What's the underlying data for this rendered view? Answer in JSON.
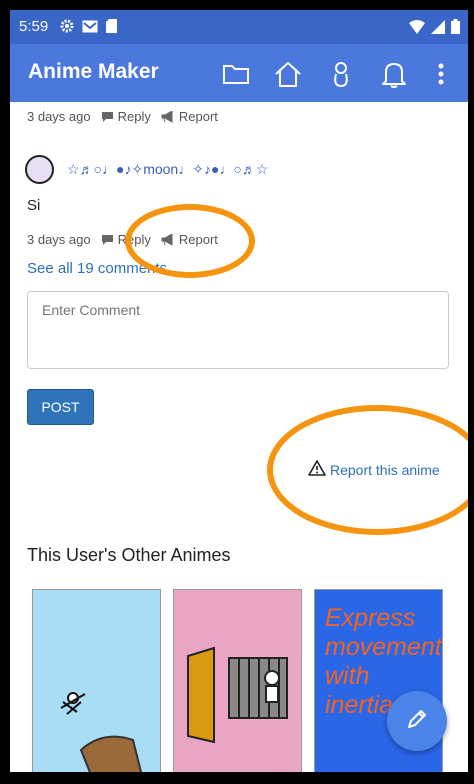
{
  "status_bar": {
    "time": "5:59"
  },
  "app_bar": {
    "title": "Anime Maker"
  },
  "comments": [
    {
      "time": "3 days ago",
      "reply": "Reply",
      "report": "Report"
    },
    {
      "username": "☆♬○♩●♪✧moon♩✧♪●♩○♬☆",
      "text": "Si",
      "time": "3 days ago",
      "reply": "Reply",
      "report": "Report"
    }
  ],
  "see_all": "See all 19 comments",
  "comment_input": {
    "placeholder": "Enter Comment"
  },
  "post_button": "POST",
  "report_anime": "Report this anime",
  "other_animes": {
    "title": "This User's Other Animes",
    "thumb3_text": "Express movement with inertia"
  },
  "colors": {
    "app_bar": "#4a78dc",
    "status_bar": "#3a66c8",
    "link": "#2f6fb5",
    "annotation": "#f5940f"
  }
}
